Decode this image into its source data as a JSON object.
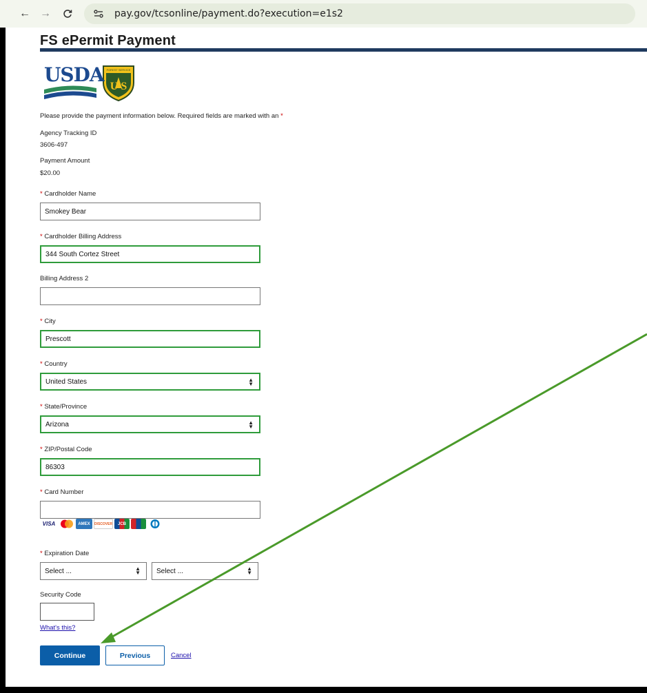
{
  "browser": {
    "url": "pay.gov/tcsonline/payment.do?execution=e1s2"
  },
  "page": {
    "title": "FS ePermit Payment",
    "logos": {
      "usda_text": "USDA",
      "forest_service": "Forest Service shield"
    },
    "intro": "Please provide the payment information below. Required fields are marked with an",
    "required_marker": "*",
    "agency_tracking": {
      "label": "Agency Tracking ID",
      "value": "3606-497"
    },
    "payment_amount": {
      "label": "Payment Amount",
      "value": "$20.00"
    }
  },
  "form": {
    "cardholder_name": {
      "label": "Cardholder Name",
      "value": "Smokey Bear",
      "required": true
    },
    "billing_address": {
      "label": "Cardholder Billing Address",
      "value": "344 South Cortez Street",
      "required": true
    },
    "billing_address2": {
      "label": "Billing Address 2",
      "value": "",
      "required": false
    },
    "city": {
      "label": "City",
      "value": "Prescott",
      "required": true
    },
    "country": {
      "label": "Country",
      "value": "United States",
      "required": true
    },
    "state": {
      "label": "State/Province",
      "value": "Arizona",
      "required": true
    },
    "zip": {
      "label": "ZIP/Postal Code",
      "value": "86303",
      "required": true
    },
    "card_number": {
      "label": "Card Number",
      "value": "",
      "required": true
    },
    "card_brands": [
      "VISA",
      "MasterCard",
      "AMEX",
      "DISCOVER",
      "JCB",
      "UnionPay",
      "Diners Club"
    ],
    "expiration": {
      "label": "Expiration Date",
      "month": "Select ...",
      "year": "Select ...",
      "required": true
    },
    "security_code": {
      "label": "Security Code",
      "value": ""
    },
    "whats_this": "What's this?"
  },
  "actions": {
    "continue": "Continue",
    "previous": "Previous",
    "cancel": "Cancel"
  },
  "colors": {
    "valid_border": "#2e9b3a",
    "primary_button": "#0b5ea8",
    "annotation_arrow": "#4a9a2a",
    "title_rule": "#1f3a5f"
  }
}
